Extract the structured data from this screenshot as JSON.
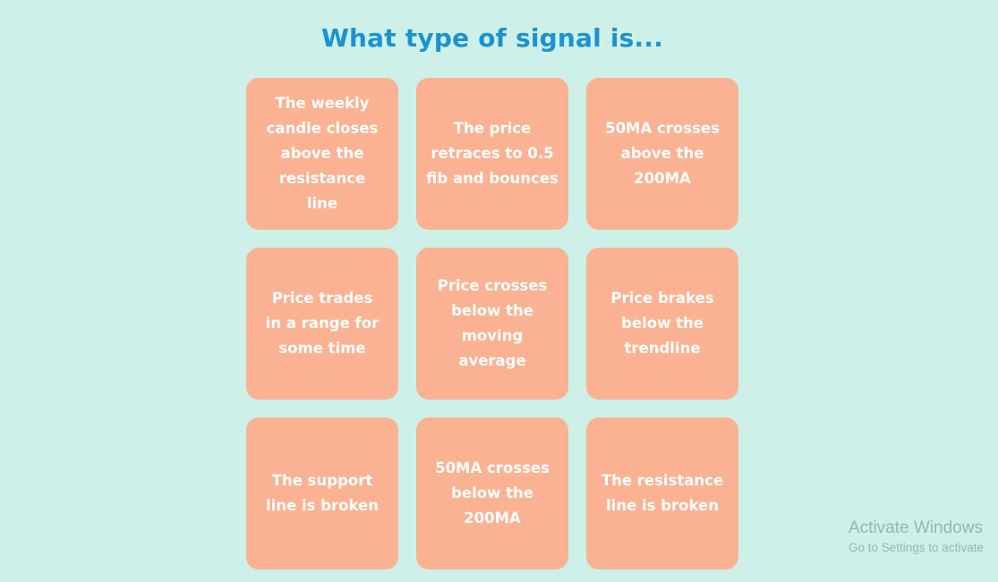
{
  "title": "What type of signal is...",
  "cards": [
    {
      "label": "The weekly candle closes above the resistance line"
    },
    {
      "label": "The price retraces to 0.5 fib and bounces"
    },
    {
      "label": "50MA crosses above the 200MA"
    },
    {
      "label": "Price trades in a range for some time"
    },
    {
      "label": "Price crosses below the moving average"
    },
    {
      "label": "Price brakes below the trendline"
    },
    {
      "label": "The support line is broken"
    },
    {
      "label": "50MA crosses below the 200MA"
    },
    {
      "label": "The resistance line is broken"
    }
  ],
  "watermark": {
    "title": "Activate Windows",
    "subtitle": "Go to Settings to activate"
  },
  "colors": {
    "background": "#cdf0e8",
    "title": "#1a93d0",
    "card": "#fbb292",
    "card_text": "#ffffff"
  }
}
